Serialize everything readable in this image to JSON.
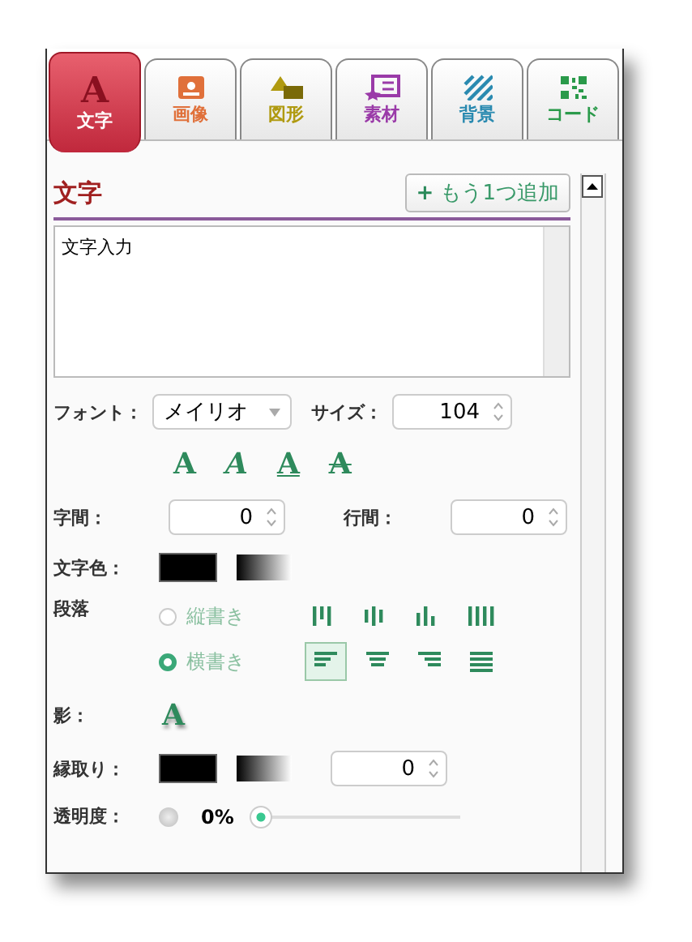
{
  "tabs": [
    {
      "label": "文字",
      "kind": "letter",
      "glyph": "A",
      "color": "#8a1020",
      "selected": true
    },
    {
      "label": "画像",
      "kind": "image",
      "color": "#e0703a",
      "selected": false
    },
    {
      "label": "図形",
      "kind": "shapes",
      "color": "#b09a10",
      "selected": false
    },
    {
      "label": "素材",
      "kind": "material",
      "color": "#9a3aa8",
      "selected": false
    },
    {
      "label": "背景",
      "kind": "stripes",
      "color": "#2a8ab0",
      "selected": false
    },
    {
      "label": "コード",
      "kind": "qr",
      "color": "#2a9a4a",
      "selected": false
    }
  ],
  "section": {
    "title": "文字",
    "add_button": {
      "icon": "+",
      "label": "もう1つ追加"
    }
  },
  "text_input": {
    "value": "文字入力"
  },
  "font": {
    "label": "フォント：",
    "value": "メイリオ"
  },
  "size": {
    "label": "サイズ：",
    "value": "104"
  },
  "style_buttons": [
    {
      "kind": "bold",
      "glyph": "A"
    },
    {
      "kind": "italic",
      "glyph": "A"
    },
    {
      "kind": "underline",
      "glyph": "A"
    },
    {
      "kind": "strike",
      "glyph": "A"
    }
  ],
  "letter_spacing": {
    "label": "字間：",
    "value": "0"
  },
  "line_spacing": {
    "label": "行間：",
    "value": "0"
  },
  "text_color": {
    "label": "文字色："
  },
  "paragraph": {
    "label": "段落",
    "options": [
      {
        "label": "縦書き",
        "selected": false,
        "aligns": [
          {
            "kind": "top",
            "selected": false
          },
          {
            "kind": "middle",
            "selected": false
          },
          {
            "kind": "bottom",
            "selected": false
          },
          {
            "kind": "justify",
            "selected": false
          }
        ]
      },
      {
        "label": "横書き",
        "selected": true,
        "aligns": [
          {
            "kind": "left",
            "selected": true
          },
          {
            "kind": "center",
            "selected": false
          },
          {
            "kind": "right",
            "selected": false
          },
          {
            "kind": "justify",
            "selected": false
          }
        ]
      }
    ]
  },
  "shadow": {
    "label": "影：",
    "glyph": "A"
  },
  "outline": {
    "label": "縁取り：",
    "value": "0"
  },
  "opacity": {
    "label": "透明度：",
    "value": "0%",
    "level": 0
  }
}
